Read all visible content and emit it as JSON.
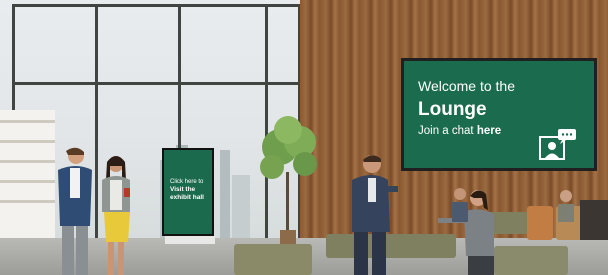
{
  "kiosk": {
    "line1": "Click here to",
    "line2": "Visit the",
    "line3": "exhibit hall",
    "color": "#1b6a4e"
  },
  "lounge_sign": {
    "welcome": "Welcome to the",
    "title": "Lounge",
    "join_prefix": "Join a chat ",
    "join_link": "here",
    "color": "#1b6c4f",
    "icon": "chat-people-icon"
  }
}
